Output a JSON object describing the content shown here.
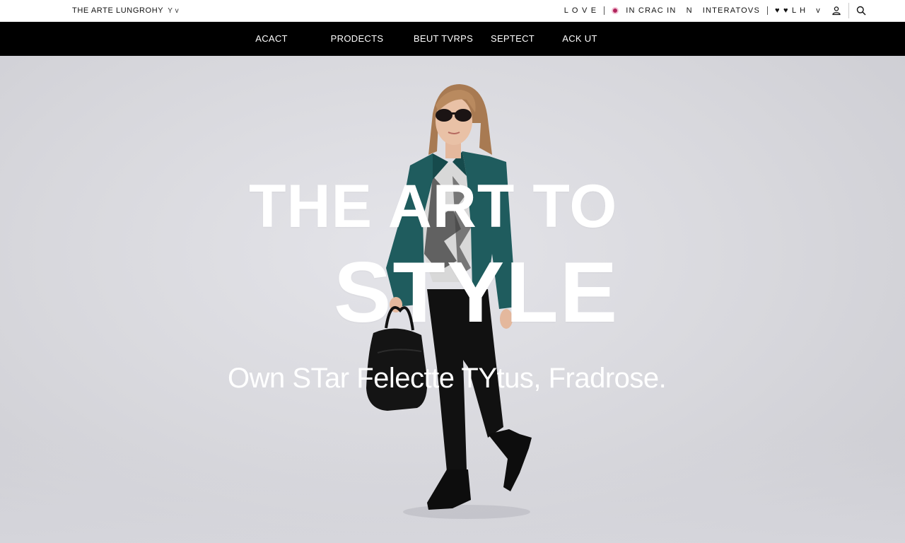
{
  "header": {
    "brand": "THE ARTE LUNGROHY",
    "brand_chevron": "Y v",
    "util_label_1": "L O V E",
    "util_label_2": "IN CRAC IN",
    "util_label_3": "N",
    "util_label_4": "INTERATOVS",
    "util_label_5": "♥ ♥ L H",
    "util_label_5_chevron": "v",
    "icons": [
      "pink-dot-icon",
      "user-icon",
      "search-icon"
    ]
  },
  "nav": {
    "items": [
      "ACACT",
      "PRODECTS",
      "BEUT TVRPS",
      "SEPTECT",
      "ACK UT"
    ]
  },
  "hero": {
    "headline_line1": "THE ART TO",
    "headline_line2": "STYLE",
    "tagline": "Own STar Felectte TYtus, Fradrose."
  },
  "colors": {
    "nav_background": "#000000",
    "hero_background": "#d9d9de",
    "accent_pink": "#b0245c",
    "jacket_teal": "#1f5c5e"
  }
}
